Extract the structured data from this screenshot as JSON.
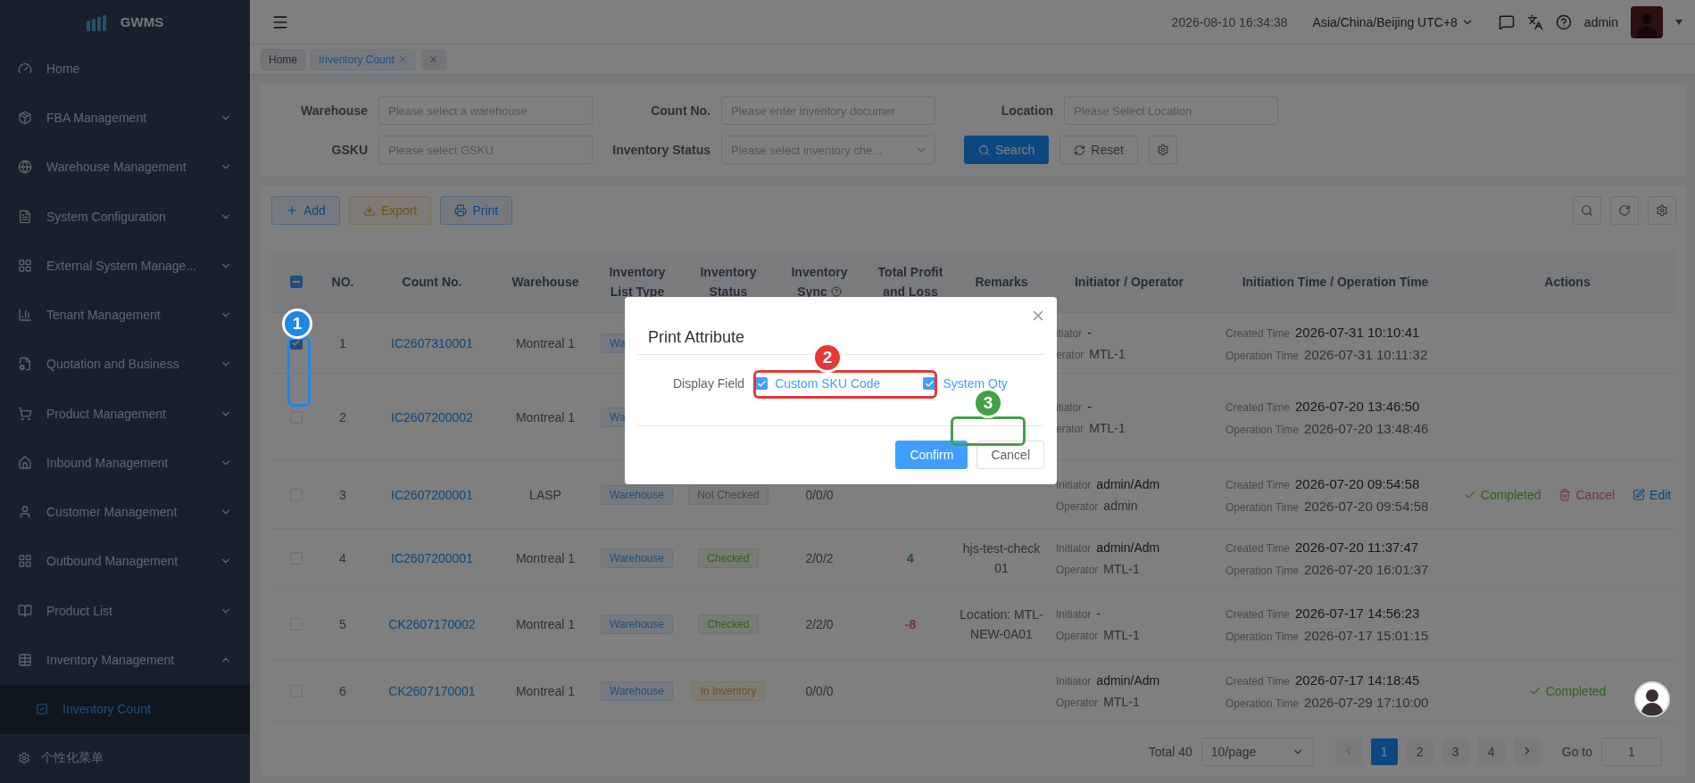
{
  "sidebar": {
    "logo": "GWMS",
    "items": [
      {
        "label": "Home"
      },
      {
        "label": "FBA Management",
        "expanded": false
      },
      {
        "label": "Warehouse Management",
        "expanded": false
      },
      {
        "label": "System Configuration",
        "expanded": false
      },
      {
        "label": "External System Manage...",
        "expanded": false
      },
      {
        "label": "Tenant Management",
        "expanded": false
      },
      {
        "label": "Quotation and Business",
        "expanded": false
      },
      {
        "label": "Product Management",
        "expanded": false
      },
      {
        "label": "Inbound Management",
        "expanded": false
      },
      {
        "label": "Customer Management",
        "expanded": false
      },
      {
        "label": "Outbound Management",
        "expanded": false
      },
      {
        "label": "Product List",
        "expanded": false
      },
      {
        "label": "Inventory Management",
        "expanded": true,
        "children": [
          {
            "label": "Inventory Count",
            "selected": true
          }
        ]
      }
    ],
    "footer": "个性化菜单"
  },
  "header": {
    "datetime": "2026-08-10 16:34:38",
    "timezone": "Asia/China/Beijing UTC+8",
    "user": "admin"
  },
  "tabs": [
    {
      "label": "Home",
      "selected": false,
      "closable": false
    },
    {
      "label": "Inventory Count",
      "selected": true,
      "closable": true
    }
  ],
  "filters": [
    {
      "label": "Warehouse",
      "placeholder": "Please select a warehouse",
      "kind": "input"
    },
    {
      "label": "Count No.",
      "placeholder": "Please enter inventory documer",
      "kind": "input"
    },
    {
      "label": "Location",
      "placeholder": "Please Select Location",
      "kind": "input"
    },
    {
      "label": "GSKU",
      "placeholder": "Please select GSKU",
      "kind": "input"
    },
    {
      "label": "Inventory Status",
      "placeholder": "Please select inventory che...",
      "kind": "select"
    }
  ],
  "filter_buttons": {
    "search": "Search",
    "reset": "Reset"
  },
  "toolbar": [
    {
      "label": "Add",
      "kind": "add"
    },
    {
      "label": "Export",
      "kind": "export"
    },
    {
      "label": "Print",
      "kind": "print"
    }
  ],
  "table": {
    "select_all": {
      "indeterminate": true
    },
    "columns": [
      "NO.",
      "Count No.",
      "Warehouse",
      "Inventory List Type",
      "Inventory Status",
      "Inventory Sync",
      "Total Profit and Loss",
      "Remarks",
      "Initiator / Operator",
      "Initiation Time / Operation Time",
      "Actions"
    ],
    "rows": [
      {
        "checked": true,
        "no": "1",
        "count_no": "IC2607310001",
        "warehouse": "Montreal 1",
        "list_type": "Wa",
        "initiator_label": "itiator",
        "initiator": "-",
        "operator_label": "erator",
        "operator": "MTL-1",
        "created_label": "Created Time",
        "created": "2026-07-31 10:10:41",
        "operated_label": "Operation Time",
        "operated": "2026-07-31 10:11:32",
        "actions": []
      },
      {
        "checked": false,
        "no": "2",
        "count_no": "IC2607200002",
        "warehouse": "Montreal 1",
        "list_type": "Wa",
        "initiator_label": "itiator",
        "initiator": "-",
        "operator_label": "erator",
        "operator": "MTL-1",
        "created_label": "Created Time",
        "created": "2026-07-20 13:46:50",
        "operated_label": "Operation Time",
        "operated": "2026-07-20 13:48:46",
        "actions": []
      },
      {
        "checked": false,
        "no": "3",
        "count_no": "IC2607200001",
        "warehouse": "LASP",
        "list_type": "Warehouse",
        "status": {
          "label": "Not Checked",
          "kind": "neutral"
        },
        "sync": "0/0/0",
        "initiator_label": "Initiator",
        "initiator": "admin/Adm",
        "operator_label": "Operator",
        "operator": "admin",
        "created_label": "Created Time",
        "created": "2026-07-20 09:54:58",
        "operated_label": "Operation Time",
        "operated": "2026-07-20 09:54:58",
        "actions": [
          {
            "label": "Completed",
            "kind": "complete"
          },
          {
            "label": "Cancel",
            "kind": "cancel"
          },
          {
            "label": "Edit",
            "kind": "edit"
          }
        ]
      },
      {
        "checked": false,
        "no": "4",
        "count_no": "IC2607200001",
        "warehouse": "Montreal 1",
        "list_type": "Warehouse",
        "status": {
          "label": "Checked",
          "kind": "success"
        },
        "sync": "2/0/2",
        "profit": {
          "value": "4",
          "kind": "gain"
        },
        "remarks": "hjs-test-check01",
        "initiator_label": "Initiator",
        "initiator": "admin/Adm",
        "operator_label": "Operator",
        "operator": "MTL-1",
        "created_label": "Created Time",
        "created": "2026-07-20 11:37:47",
        "operated_label": "Operation Time",
        "operated": "2026-07-20 16:01:37",
        "actions": []
      },
      {
        "checked": false,
        "no": "5",
        "count_no": "CK2607170002",
        "warehouse": "Montreal 1",
        "list_type": "Warehouse",
        "status": {
          "label": "Checked",
          "kind": "success"
        },
        "sync": "2/2/0",
        "profit": {
          "value": "-8",
          "kind": "loss"
        },
        "remarks": "Location: MTL-NEW-0A01",
        "initiator_label": "Initiator",
        "initiator": "-",
        "operator_label": "Operator",
        "operator": "MTL-1",
        "created_label": "Created Time",
        "created": "2026-07-17 14:56:23",
        "operated_label": "Operation Time",
        "operated": "2026-07-17 15:01:15",
        "actions": []
      },
      {
        "checked": false,
        "no": "6",
        "count_no": "CK2607170001",
        "warehouse": "Montreal 1",
        "list_type": "Warehouse",
        "status": {
          "label": "In Inventory",
          "kind": "warning"
        },
        "sync": "0/0/0",
        "initiator_label": "Initiator",
        "initiator": "admin/Adm",
        "operator_label": "Operator",
        "operator": "MTL-1",
        "created_label": "Created Time",
        "created": "2026-07-17 14:18:45",
        "operated_label": "Operation Time",
        "operated": "2026-07-29 17:10:00",
        "actions": [
          {
            "label": "Completed",
            "kind": "complete"
          }
        ]
      }
    ]
  },
  "pagination": {
    "total": "Total 40",
    "page_size": "10/page",
    "pages": [
      {
        "label": "1",
        "selected": true
      },
      {
        "label": "2",
        "selected": false
      },
      {
        "label": "3",
        "selected": false
      },
      {
        "label": "4",
        "selected": false
      }
    ],
    "goto_label": "Go to",
    "goto_value": "1"
  },
  "modal": {
    "title": "Print Attribute",
    "field_label": "Display Field",
    "options": [
      {
        "label": "Custom SKU Code",
        "checked": true
      },
      {
        "label": "System Qty",
        "checked": true
      }
    ],
    "confirm": "Confirm",
    "cancel": "Cancel"
  },
  "annotations": [
    {
      "number": "1",
      "color": "#1e88e5"
    },
    {
      "number": "2",
      "color": "#e53935"
    },
    {
      "number": "3",
      "color": "#43a047"
    }
  ]
}
